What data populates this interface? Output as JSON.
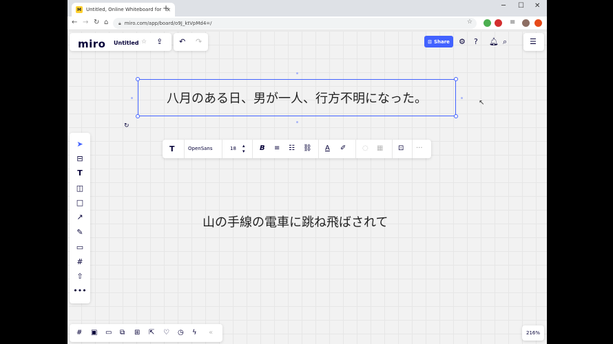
{
  "browser": {
    "tab_title": "Untitled, Online Whiteboard for",
    "tab_favicon": "M",
    "url": "miro.com/app/board/o9J_ktVpMd4=/"
  },
  "header": {
    "logo": "miro",
    "board_name": "Untitled",
    "share_label": "Share"
  },
  "format_toolbar": {
    "font_name": "OpenSans",
    "font_size": "18"
  },
  "canvas": {
    "selected_text": "八月のある日、男が一人、行方不明になった。",
    "second_text": "山の手線の電車に跳ね飛ばされて"
  },
  "zoom_level": "216%",
  "colors": {
    "accent": "#4262ff",
    "ink": "#050038"
  }
}
